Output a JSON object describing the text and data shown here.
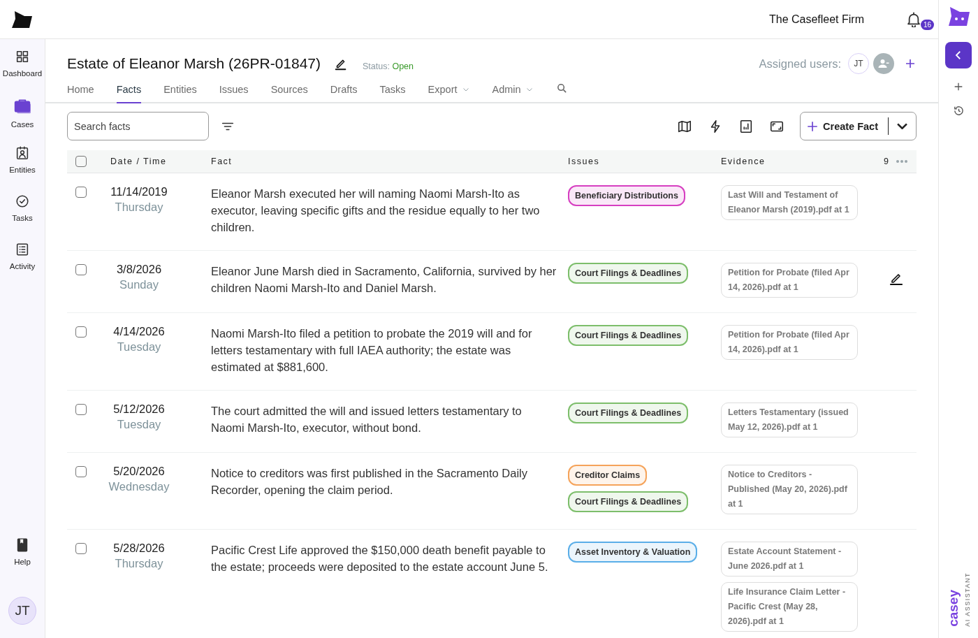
{
  "top_bar": {
    "firm": "The Casefleet Firm",
    "notification_count": "16"
  },
  "sidebar": {
    "items": [
      {
        "label": "Dashboard",
        "selected": false
      },
      {
        "label": "Cases",
        "selected": true
      },
      {
        "label": "Entities",
        "selected": false
      },
      {
        "label": "Tasks",
        "selected": false
      },
      {
        "label": "Activity",
        "selected": false
      }
    ],
    "help": "Help",
    "avatar": "JT"
  },
  "case": {
    "title": "Estate of Eleanor Marsh (26PR-01847)",
    "status_label": "Status:",
    "status": "Open",
    "assigned_label": "Assigned users:",
    "assigned": [
      "JT"
    ]
  },
  "tabs": [
    {
      "label": "Home",
      "selected": false,
      "kind": "plain"
    },
    {
      "label": "Facts",
      "selected": true,
      "kind": "plain"
    },
    {
      "label": "Entities",
      "selected": false,
      "kind": "plain"
    },
    {
      "label": "Issues",
      "selected": false,
      "kind": "plain"
    },
    {
      "label": "Sources",
      "selected": false,
      "kind": "plain"
    },
    {
      "label": "Drafts",
      "selected": false,
      "kind": "plain"
    },
    {
      "label": "Tasks",
      "selected": false,
      "kind": "plain"
    },
    {
      "label": "Export",
      "selected": false,
      "kind": "dropdown"
    },
    {
      "label": "Admin",
      "selected": false,
      "kind": "dropdown"
    }
  ],
  "toolbar": {
    "search": {
      "placeholder": "Search facts"
    },
    "create_button": "Create Fact"
  },
  "table": {
    "columns": [
      "Date / Time",
      "Fact",
      "Issues",
      "Evidence"
    ],
    "count": "9",
    "all_checked": false,
    "rows": [
      {
        "date": "11/14/2019",
        "weekday": "Thursday",
        "fact": "Eleanor Marsh executed her will naming Naomi Marsh-Ito as executor, leaving specific gifts and the residue equally to her two children.",
        "checked": false,
        "hovered": false,
        "issues": [
          {
            "label": "Beneficiary Distributions",
            "color": "#d63fc1"
          }
        ],
        "evidence": [
          "Last Will and Testament of Eleanor Marsh (2019).pdf at 1"
        ]
      },
      {
        "date": "3/8/2026",
        "weekday": "Sunday",
        "fact": "Eleanor June Marsh died in Sacramento, California, survived by her children Naomi Marsh-Ito and Daniel Marsh.",
        "checked": false,
        "hovered": true,
        "issues": [
          {
            "label": "Court Filings & Deadlines",
            "color": "#7dbe6b"
          }
        ],
        "evidence": [
          "Petition for Probate (filed Apr 14, 2026).pdf at 1"
        ]
      },
      {
        "date": "4/14/2026",
        "weekday": "Tuesday",
        "fact": "Naomi Marsh-Ito filed a petition to probate the 2019 will and for letters testamentary with full IAEA authority; the estate was estimated at $881,600.",
        "checked": false,
        "hovered": false,
        "issues": [
          {
            "label": "Court Filings & Deadlines",
            "color": "#7dbe6b"
          }
        ],
        "evidence": [
          "Petition for Probate (filed Apr 14, 2026).pdf at 1"
        ]
      },
      {
        "date": "5/12/2026",
        "weekday": "Tuesday",
        "fact": "The court admitted the will and issued letters testamentary to Naomi Marsh-Ito, executor, without bond.",
        "checked": false,
        "hovered": false,
        "issues": [
          {
            "label": "Court Filings & Deadlines",
            "color": "#7dbe6b"
          }
        ],
        "evidence": [
          "Letters Testamentary (issued May 12, 2026).pdf at 1"
        ]
      },
      {
        "date": "5/20/2026",
        "weekday": "Wednesday",
        "fact": "Notice to creditors was first published in the Sacramento Daily Recorder, opening the claim period.",
        "checked": false,
        "hovered": false,
        "issues": [
          {
            "label": "Creditor Claims",
            "color": "#f5a35a"
          },
          {
            "label": "Court Filings & Deadlines",
            "color": "#7dbe6b"
          }
        ],
        "evidence": [
          "Notice to Creditors - Published (May 20, 2026).pdf at 1"
        ]
      },
      {
        "date": "5/28/2026",
        "weekday": "Thursday",
        "fact": "Pacific Crest Life approved the $150,000 death benefit payable to the estate; proceeds were deposited to the estate account June 5.",
        "checked": false,
        "hovered": false,
        "issues": [
          {
            "label": "Asset Inventory & Valuation",
            "color": "#5aaee8"
          }
        ],
        "evidence": [
          "Estate Account Statement - June 2026.pdf at 1",
          "Life Insurance Claim Letter - Pacific Crest (May 28, 2026).pdf at 1"
        ]
      }
    ]
  },
  "assistant": {
    "brand": "casey",
    "subtitle": "AI ASSISTANT"
  }
}
